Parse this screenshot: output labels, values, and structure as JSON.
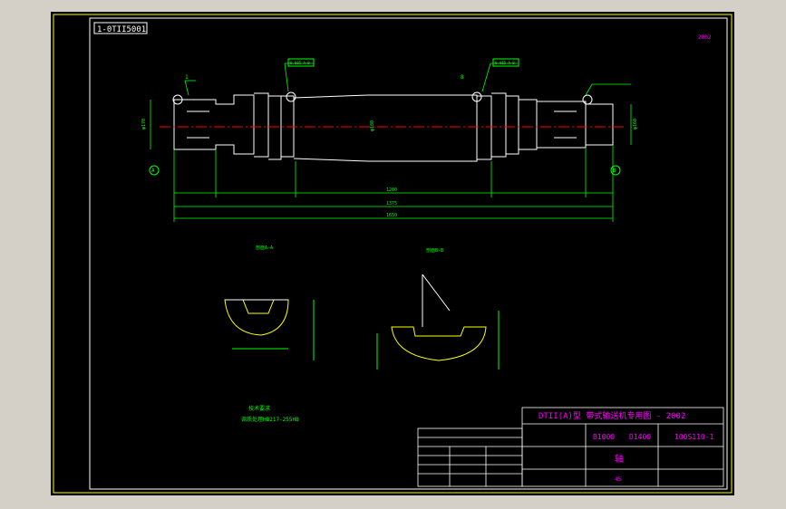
{
  "drawing": {
    "code_box": "1-0TII5001",
    "scale_mark": "2002",
    "title_block": {
      "title": "DTII(A)型  带式输送机专用图 - 2002",
      "spec_1": "B1000",
      "spec_2": "D1400",
      "drawing_no": "100S110-1",
      "part_name": "轴",
      "material": "45"
    },
    "tech_req": {
      "heading": "技术要求",
      "line1": "调质处理HB217-255HB"
    },
    "section_a": {
      "label": "剖面A-A"
    },
    "section_b": {
      "label": "剖面B-B"
    },
    "bearing_labels": [
      "1",
      "8"
    ],
    "section_markers": [
      "A",
      "B"
    ],
    "tolerance_tags": [
      "0.015 A-B",
      "0.015 A-B"
    ],
    "dims": [
      "1200",
      "1375",
      "1650",
      "φ170",
      "φ180",
      "φ160"
    ]
  },
  "colors": {
    "background": "#000000",
    "frame": "#ffffff",
    "outline": "#ffffff",
    "dimension": "#00ff00",
    "centerline": "#ff0000",
    "title": "#ff00ff",
    "hatch_yellow": "#ffff00"
  }
}
